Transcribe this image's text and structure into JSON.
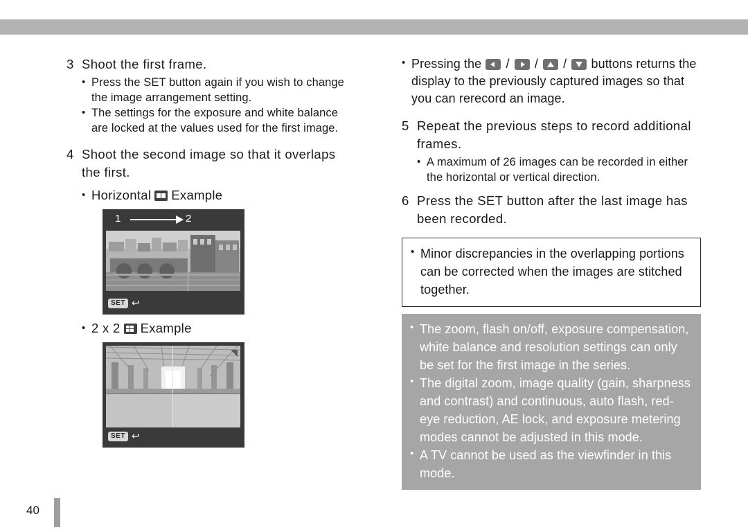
{
  "page": {
    "number": "40"
  },
  "left_column": {
    "step3": {
      "num": "3",
      "text": "Shoot the first frame.",
      "bullets": [
        "Press the SET button again if you wish to change the image arrangement setting.",
        "The settings for the exposure and white balance are locked at the values used for the first image."
      ]
    },
    "step4": {
      "num": "4",
      "text": "Shoot the second image so that it overlaps the first.",
      "caption_horizontal_prefix": "Horizontal",
      "caption_horizontal_suffix": "Example",
      "caption_grid_prefix": "2 x 2",
      "caption_grid_suffix": "Example"
    },
    "figure_horizontal": {
      "label_left": "1",
      "label_right": "2",
      "set_label": "SET",
      "return_glyph": "↩",
      "arrow_icon": "right-arrow-icon"
    },
    "figure_grid": {
      "set_label": "SET",
      "return_glyph": "↩"
    }
  },
  "right_column": {
    "top_bullet": {
      "pre": "Pressing the",
      "post": "buttons returns the display to the previously captured images so that you can rerecord an image.",
      "keys": [
        "left-arrow-key",
        "right-arrow-key",
        "up-arrow-key",
        "down-arrow-key"
      ],
      "separator": "/"
    },
    "step5": {
      "num": "5",
      "text": "Repeat the previous steps to record additional frames.",
      "bullets": [
        "A maximum of 26 images can be recorded in either the horizontal or vertical direction."
      ]
    },
    "step6": {
      "num": "6",
      "text": "Press the SET button after the last image has been recorded."
    },
    "note_box": {
      "bullets": [
        "Minor discrepancies in the overlapping portions can be corrected when the images are stitched together."
      ]
    },
    "warning_box": {
      "bullets": [
        "The zoom, flash on/off, exposure compensation, white balance and resolution settings can only be set for the first image in the series.",
        "The digital zoom, image quality (gain, sharpness and contrast) and continuous, auto flash, red-eye reduction, AE lock, and exposure metering modes cannot be adjusted in this mode.",
        "A TV cannot be used as the viewfinder in this mode."
      ]
    }
  },
  "colors": {
    "top_band": "#b3b3b3",
    "warning_box_bg": "#a6a6a6",
    "figure_bg": "#3a3a3a",
    "page_bar": "#9d9d9d"
  },
  "glyphs": {
    "bullet": "•"
  }
}
